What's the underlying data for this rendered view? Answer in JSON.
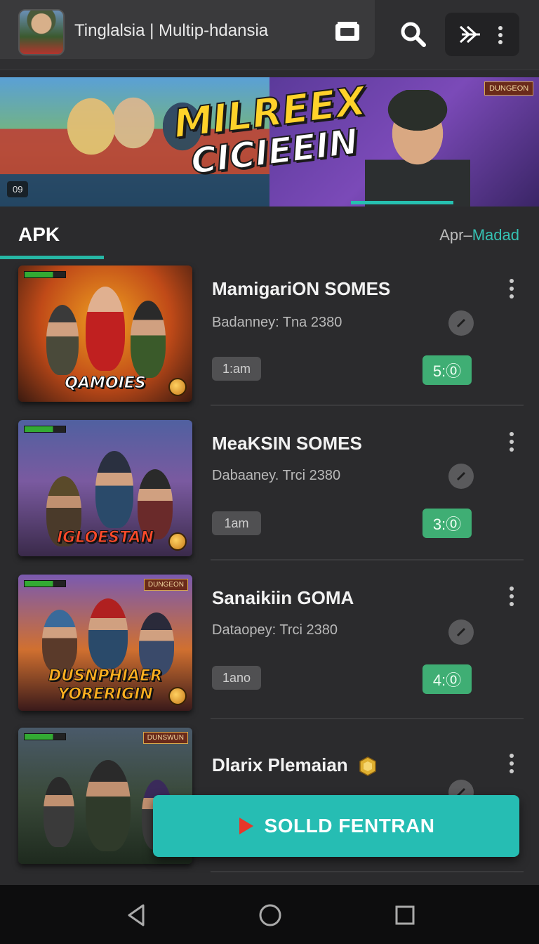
{
  "header": {
    "title": "Tinglalsia | Multip-hdansia",
    "icons": [
      "app-avatar",
      "cast-icon",
      "search-icon",
      "forward-icon",
      "more-vert-icon"
    ]
  },
  "banner": {
    "title_line1": "MILREEX",
    "title_line2": "CICIEEIN",
    "badge": "DUNGEON",
    "counter": "09"
  },
  "tabs": {
    "left": "APK",
    "right_prefix": "Apr–",
    "right_accent": "Madad"
  },
  "items": [
    {
      "title": "MamigariON SOMES",
      "subtitle": "Badanney: Tna 2380",
      "time": "1:am",
      "rating": "5:⓪",
      "thumb_label": "QAMOIES"
    },
    {
      "title": "MeaKSIN SOMES",
      "subtitle": "Dabaaney. Trci 2380",
      "time": "1am",
      "rating": "3:⓪",
      "thumb_label": "IGLOESTAN"
    },
    {
      "title": "Sanaikiin GOMA",
      "subtitle": "Dataopey: Trci 2380",
      "time": "1ano",
      "rating": "4:⓪",
      "thumb_label": "DUSNPHIAER YORERIGIN",
      "thumb_badge": "DUNGEON"
    },
    {
      "title": "Dlarix Plemaian",
      "subtitle": "",
      "time": "",
      "rating": "",
      "thumb_label": "",
      "thumb_badge": "DUNSWUN"
    }
  ],
  "cta": {
    "label": "SOLLD FENTRAN"
  },
  "colors": {
    "accent": "#26bdb3",
    "rating": "#3fae74",
    "background": "#2b2b2d"
  }
}
